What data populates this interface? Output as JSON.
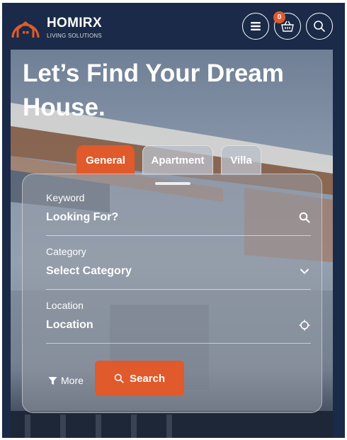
{
  "header": {
    "brand": "HOMIRX",
    "tagline": "LIVING SOLUTIONS",
    "cart_count": "0",
    "icons": {
      "logo": "house-logo-icon",
      "menu": "hamburger-icon",
      "cart": "basket-icon",
      "search": "search-icon"
    }
  },
  "hero": {
    "title_line1": "Let’s Find Your Dream",
    "title_line2": "House."
  },
  "tabs": [
    {
      "label": "General",
      "active": true
    },
    {
      "label": "Apartment",
      "active": false
    },
    {
      "label": "Villa",
      "active": false
    }
  ],
  "form": {
    "keyword": {
      "label": "Keyword",
      "value": "Looking For?",
      "icon": "search-icon"
    },
    "category": {
      "label": "Category",
      "value": "Select Category",
      "icon": "chevron-down-icon"
    },
    "location": {
      "label": "Location",
      "value": "Location",
      "icon": "crosshair-icon"
    },
    "more_label": "More",
    "search_label": "Search"
  },
  "colors": {
    "navy": "#1a2a48",
    "accent": "#e05a2b"
  }
}
